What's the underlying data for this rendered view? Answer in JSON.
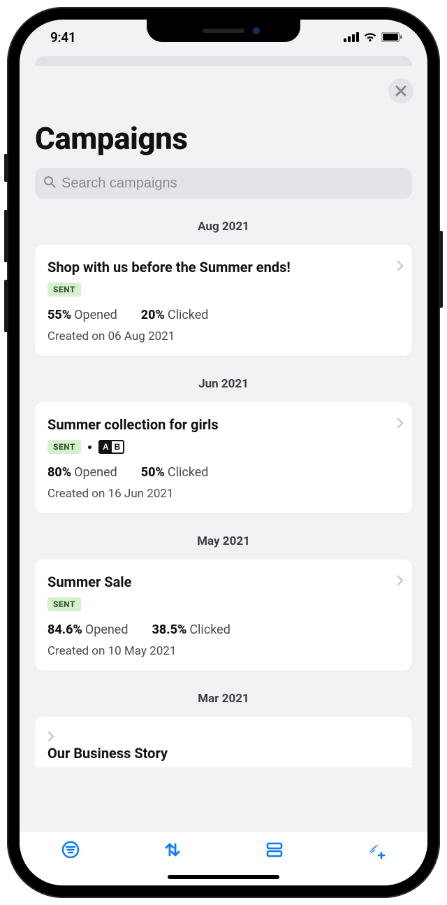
{
  "status_bar": {
    "time": "9:41"
  },
  "page": {
    "title": "Campaigns"
  },
  "search": {
    "placeholder": "Search campaigns"
  },
  "sections": [
    {
      "month": "Aug 2021",
      "campaign": {
        "title": "Shop with us before the Summer ends!",
        "status": "SENT",
        "ab": false,
        "opened_pct": "55%",
        "opened_label": "Opened",
        "clicked_pct": "20%",
        "clicked_label": "Clicked",
        "created": "Created on 06 Aug 2021"
      }
    },
    {
      "month": "Jun 2021",
      "campaign": {
        "title": "Summer collection for girls",
        "status": "SENT",
        "ab": true,
        "opened_pct": "80%",
        "opened_label": "Opened",
        "clicked_pct": "50%",
        "clicked_label": "Clicked",
        "created": "Created on 16 Jun 2021"
      }
    },
    {
      "month": "May 2021",
      "campaign": {
        "title": "Summer Sale",
        "status": "SENT",
        "ab": false,
        "opened_pct": "84.6%",
        "opened_label": "Opened",
        "clicked_pct": "38.5%",
        "clicked_label": "Clicked",
        "created": "Created on 10 May 2021"
      }
    },
    {
      "month": "Mar 2021",
      "campaign": {
        "title": "Our Business Story"
      }
    }
  ],
  "colors": {
    "accent": "#0a7bff"
  }
}
